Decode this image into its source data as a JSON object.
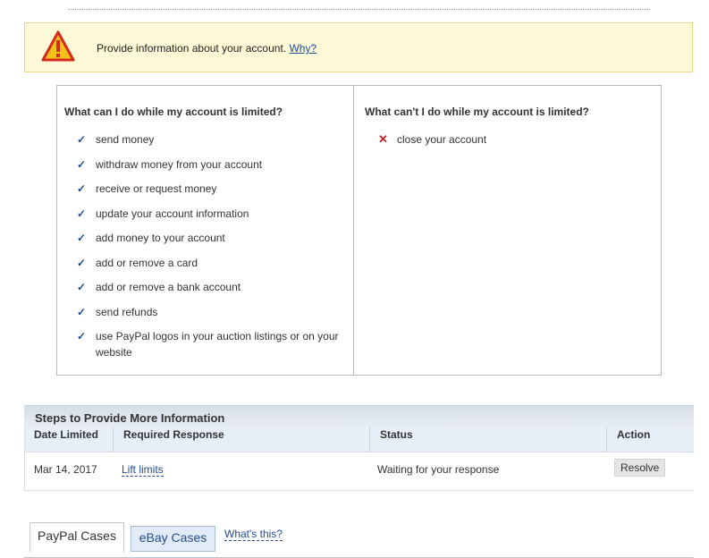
{
  "alert": {
    "message": "Provide information about your account.",
    "link": "Why?",
    "icon": "warning-icon"
  },
  "can_do": {
    "title": "What can I do while my account is limited?",
    "items": [
      "send money",
      "withdraw money from your account",
      "receive or request money",
      "update your account information",
      "add money to your account",
      "add or remove a card",
      "add or remove a bank account",
      "send refunds",
      "use PayPal logos in your auction listings or on your website"
    ]
  },
  "cant_do": {
    "title": "What can't I do while my account is limited?",
    "items": [
      "close your account"
    ]
  },
  "steps": {
    "title": "Steps to Provide More Information",
    "columns": [
      "Date Limited",
      "Required Response",
      "Status",
      "Action"
    ],
    "rows": [
      {
        "date": "Mar 14, 2017",
        "response": "Lift limits",
        "status": "Waiting for your response",
        "action": "Resolve"
      }
    ]
  },
  "tabs": {
    "paypal": "PayPal Cases",
    "ebay": "eBay Cases",
    "whats_this": "What's this?"
  },
  "colors": {
    "accent": "#224e91",
    "alert_bg": "#fefad7",
    "check": "#1d4c8f",
    "x": "#cc1f1f"
  }
}
